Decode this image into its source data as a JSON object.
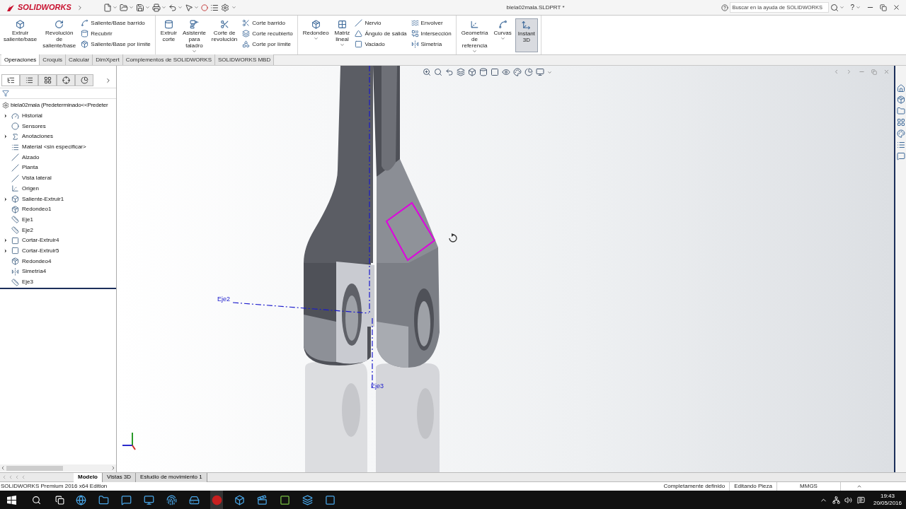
{
  "app": {
    "logo": "SOLIDWORKS",
    "title": "biela02mala.SLDPRT *",
    "search_placeholder": "Buscar en la ayuda de SOLIDWORKS",
    "help": "?"
  },
  "ribbon": {
    "groups": [
      {
        "items": [
          {
            "kind": "large",
            "label": "Extruir\nsaliente/base",
            "dropdown": false,
            "selected": false
          },
          {
            "kind": "large",
            "label": "Revolución\nde\nsaliente/base",
            "dropdown": false,
            "selected": false
          },
          {
            "kind": "stack",
            "entries": [
              "Saliente/Base barrido",
              "Recubrir",
              "Saliente/Base por límite"
            ]
          }
        ]
      },
      {
        "items": [
          {
            "kind": "large",
            "label": "Extruir\ncorte",
            "dropdown": false,
            "selected": false
          },
          {
            "kind": "large",
            "label": "Asistente\npara\ntaladro",
            "dropdown": true,
            "selected": false
          },
          {
            "kind": "large",
            "label": "Corte de\nrevolución",
            "dropdown": false,
            "selected": false
          },
          {
            "kind": "stack",
            "entries": [
              "Corte barrido",
              "Corte recubierto",
              "Corte por límite"
            ]
          }
        ]
      },
      {
        "items": [
          {
            "kind": "large",
            "label": "Redondeo",
            "dropdown": true,
            "selected": false
          },
          {
            "kind": "large",
            "label": "Matriz\nlineal",
            "dropdown": true,
            "selected": false
          },
          {
            "kind": "stack",
            "entries": [
              "Nervio",
              "Ángulo de salida",
              "Vaciado"
            ]
          },
          {
            "kind": "stack",
            "entries": [
              "Envolver",
              "Intersección",
              "Simetría"
            ]
          }
        ]
      },
      {
        "items": [
          {
            "kind": "large",
            "label": "Geometría\nde\nreferencia",
            "dropdown": true,
            "selected": false
          },
          {
            "kind": "large",
            "label": "Curvas",
            "dropdown": true,
            "selected": false
          },
          {
            "kind": "large",
            "label": "Instant\n3D",
            "dropdown": false,
            "selected": true
          }
        ]
      }
    ]
  },
  "command_tabs": [
    {
      "label": "Operaciones",
      "selected": true
    },
    {
      "label": "Croquis",
      "selected": false
    },
    {
      "label": "Calcular",
      "selected": false
    },
    {
      "label": "DimXpert",
      "selected": false
    },
    {
      "label": "Complementos de SOLIDWORKS",
      "selected": false
    },
    {
      "label": "SOLIDWORKS MBD",
      "selected": false
    }
  ],
  "panel_tabs": [
    {
      "selected": true
    },
    {
      "selected": false
    },
    {
      "selected": false
    },
    {
      "selected": false
    },
    {
      "selected": false
    }
  ],
  "feature_tree": {
    "root": "biela02mala (Predeterminado<<Predeter",
    "items": [
      {
        "label": "Historial",
        "expandable": true
      },
      {
        "label": "Sensores",
        "expandable": false
      },
      {
        "label": "Anotaciones",
        "expandable": true
      },
      {
        "label": "Material <sin especificar>",
        "expandable": false
      },
      {
        "label": "Alzado",
        "expandable": false
      },
      {
        "label": "Planta",
        "expandable": false
      },
      {
        "label": "Vista lateral",
        "expandable": false
      },
      {
        "label": "Origen",
        "expandable": false
      },
      {
        "label": "Saliente-Extruir1",
        "expandable": true
      },
      {
        "label": "Redondeo1",
        "expandable": false
      },
      {
        "label": "Eje1",
        "expandable": false
      },
      {
        "label": "Eje2",
        "expandable": false
      },
      {
        "label": "Cortar-Extruir4",
        "expandable": true
      },
      {
        "label": "Cortar-Extruir5",
        "expandable": true
      },
      {
        "label": "Redondeo4",
        "expandable": false
      },
      {
        "label": "Simetría4",
        "expandable": false
      },
      {
        "label": "Eje3",
        "expandable": false
      }
    ]
  },
  "viewport": {
    "annotations": [
      {
        "label": "Eje2"
      },
      {
        "label": "Eje3"
      }
    ]
  },
  "bottom_tabs": [
    {
      "label": "Modelo",
      "selected": true
    },
    {
      "label": "Vistas 3D",
      "selected": false
    },
    {
      "label": "Estudio de movimiento 1",
      "selected": false
    }
  ],
  "status_bar": {
    "edition": "SOLIDWORKS Premium 2016 x64 Edition",
    "fields": [
      "Completamente definido",
      "Editando Pieza",
      "MMGS"
    ]
  },
  "taskbar": {
    "time": "19:43",
    "date": "20/05/2016"
  }
}
